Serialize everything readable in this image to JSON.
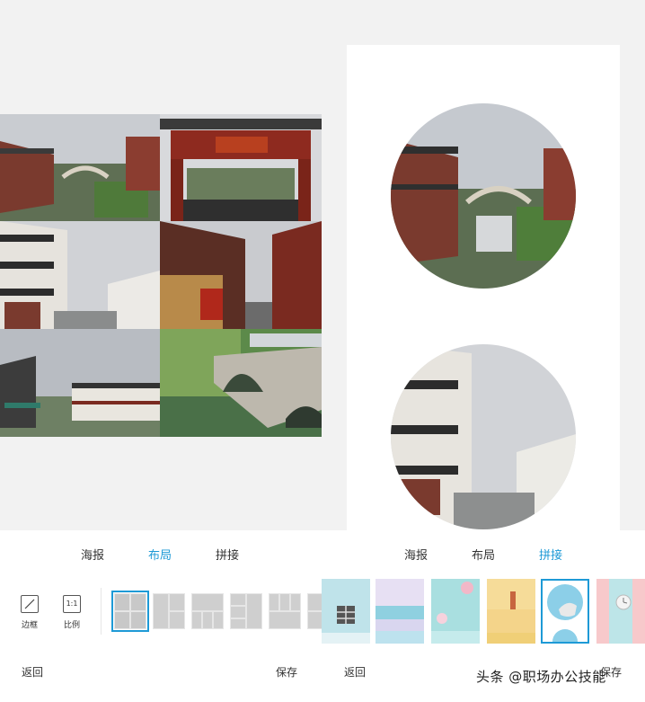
{
  "left_panel": {
    "tabs": [
      {
        "label": "海报",
        "active": false
      },
      {
        "label": "布局",
        "active": true
      },
      {
        "label": "拼接",
        "active": false
      }
    ],
    "tools": [
      {
        "label": "边框",
        "icon": "border-slash-icon"
      },
      {
        "label": "比例",
        "icon": "ratio-icon",
        "icon_text": "1:1"
      }
    ],
    "layout_count": 6,
    "back_label": "返回",
    "save_label": "保存"
  },
  "right_panel": {
    "tabs": [
      {
        "label": "海报",
        "active": false
      },
      {
        "label": "布局",
        "active": false
      },
      {
        "label": "拼接",
        "active": true
      }
    ],
    "back_label": "返回",
    "save_label": "保存"
  },
  "watermark": "头条 @职场办公技能",
  "colors": {
    "accent": "#1e9ad6",
    "background": "#f2f2f2"
  }
}
